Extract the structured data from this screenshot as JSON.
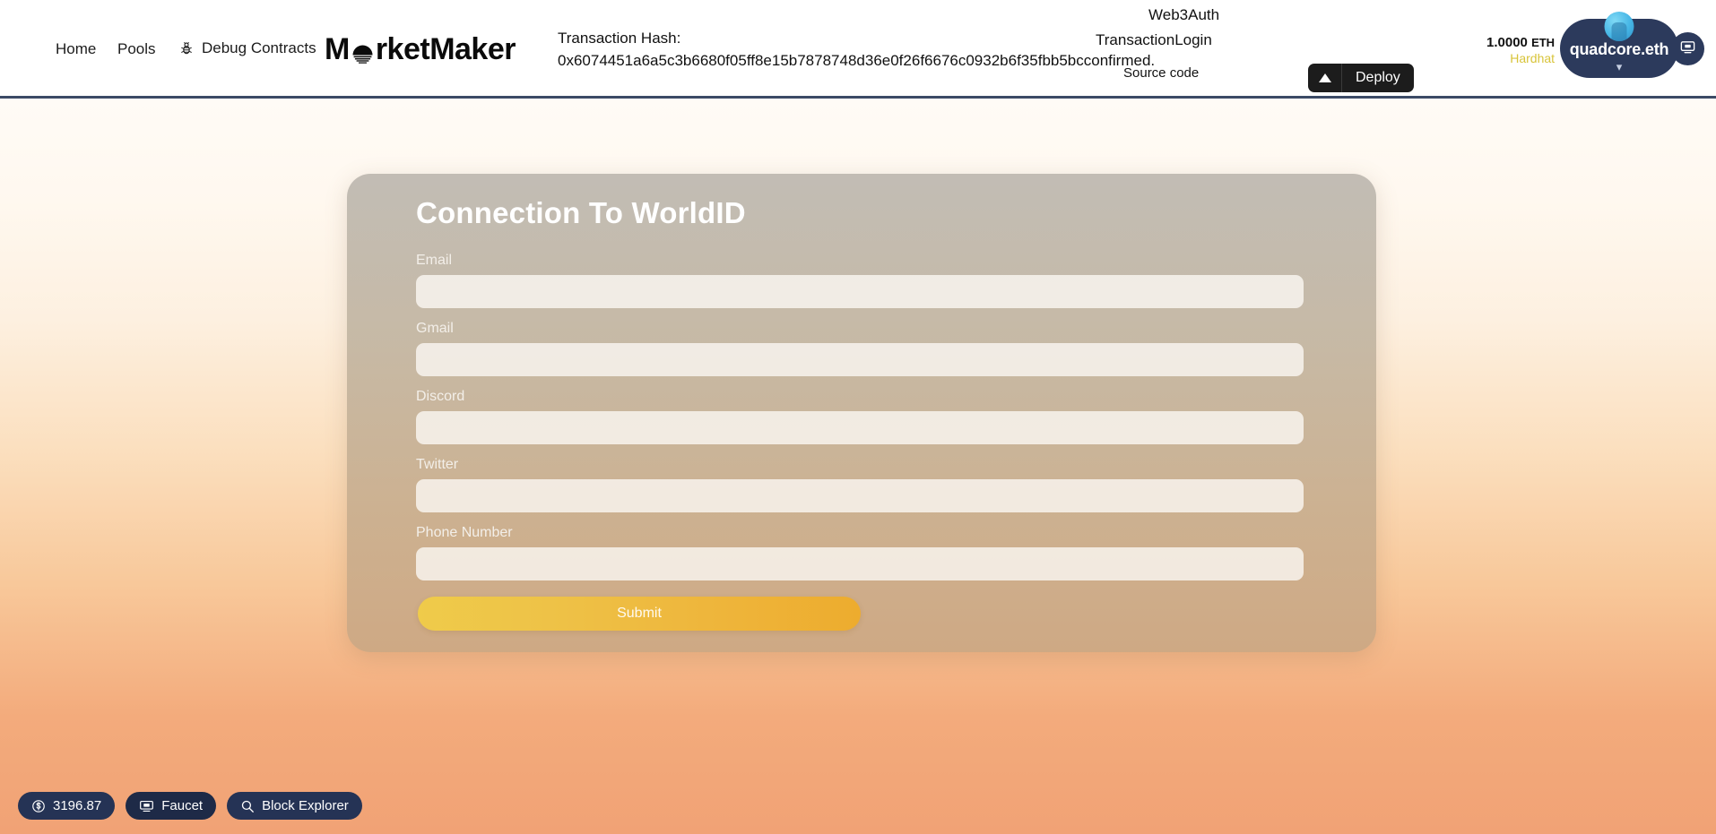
{
  "header": {
    "nav": [
      {
        "label": "Home",
        "name": "nav-home"
      },
      {
        "label": "Pools",
        "name": "nav-pools"
      },
      {
        "label": "Debug Contracts",
        "name": "nav-debug",
        "icon": "bug-icon"
      }
    ],
    "logo": {
      "text_before": "M",
      "mark": "sun-logo-mark",
      "text_after": "rketMaker"
    },
    "transaction": {
      "label": "Transaction Hash:",
      "value": "0x6074451a6a5c3b6680f05ff8e15b7878748d36e0f26f6676c0932b6f35fbb5bcconfirmed."
    },
    "web3auth_label": "Web3Auth",
    "transaction_login_label": "TransactionLogin",
    "source_code_label": "Source code",
    "deploy": {
      "label": "Deploy",
      "caret_icon": "caret-up-icon"
    },
    "balance": {
      "amount": "1.0000",
      "unit": "ETH",
      "network": "Hardhat"
    },
    "wallet": {
      "name": "quadcore.eth",
      "caret_icon": "chevron-down-icon",
      "avatar_icon": "wallet-avatar"
    },
    "screen_button_icon": "screen-icon"
  },
  "card": {
    "title": "Connection To WorldID",
    "fields": [
      {
        "label": "Email",
        "value": "",
        "placeholder": "",
        "name": "email-field"
      },
      {
        "label": "Gmail",
        "value": "",
        "placeholder": "",
        "name": "gmail-field"
      },
      {
        "label": "Discord",
        "value": "",
        "placeholder": "",
        "name": "discord-field"
      },
      {
        "label": "Twitter",
        "value": "",
        "placeholder": "",
        "name": "twitter-field"
      },
      {
        "label": "Phone Number",
        "value": "",
        "placeholder": "",
        "name": "phone-number-field"
      }
    ],
    "submit_label": "Submit"
  },
  "status_bar": [
    {
      "label": "3196.87",
      "icon": "dollar-circle-icon",
      "name": "gas-price-pill"
    },
    {
      "label": "Faucet",
      "icon": "faucet-icon",
      "name": "faucet-pill"
    },
    {
      "label": "Block Explorer",
      "icon": "search-icon",
      "name": "block-explorer-pill"
    }
  ],
  "colors": {
    "accent_yellow": "#eec247",
    "navy": "#253355",
    "network_yellow": "#d8c43a",
    "bg_top": "#fffbf6",
    "bg_bottom": "#f1a275"
  }
}
